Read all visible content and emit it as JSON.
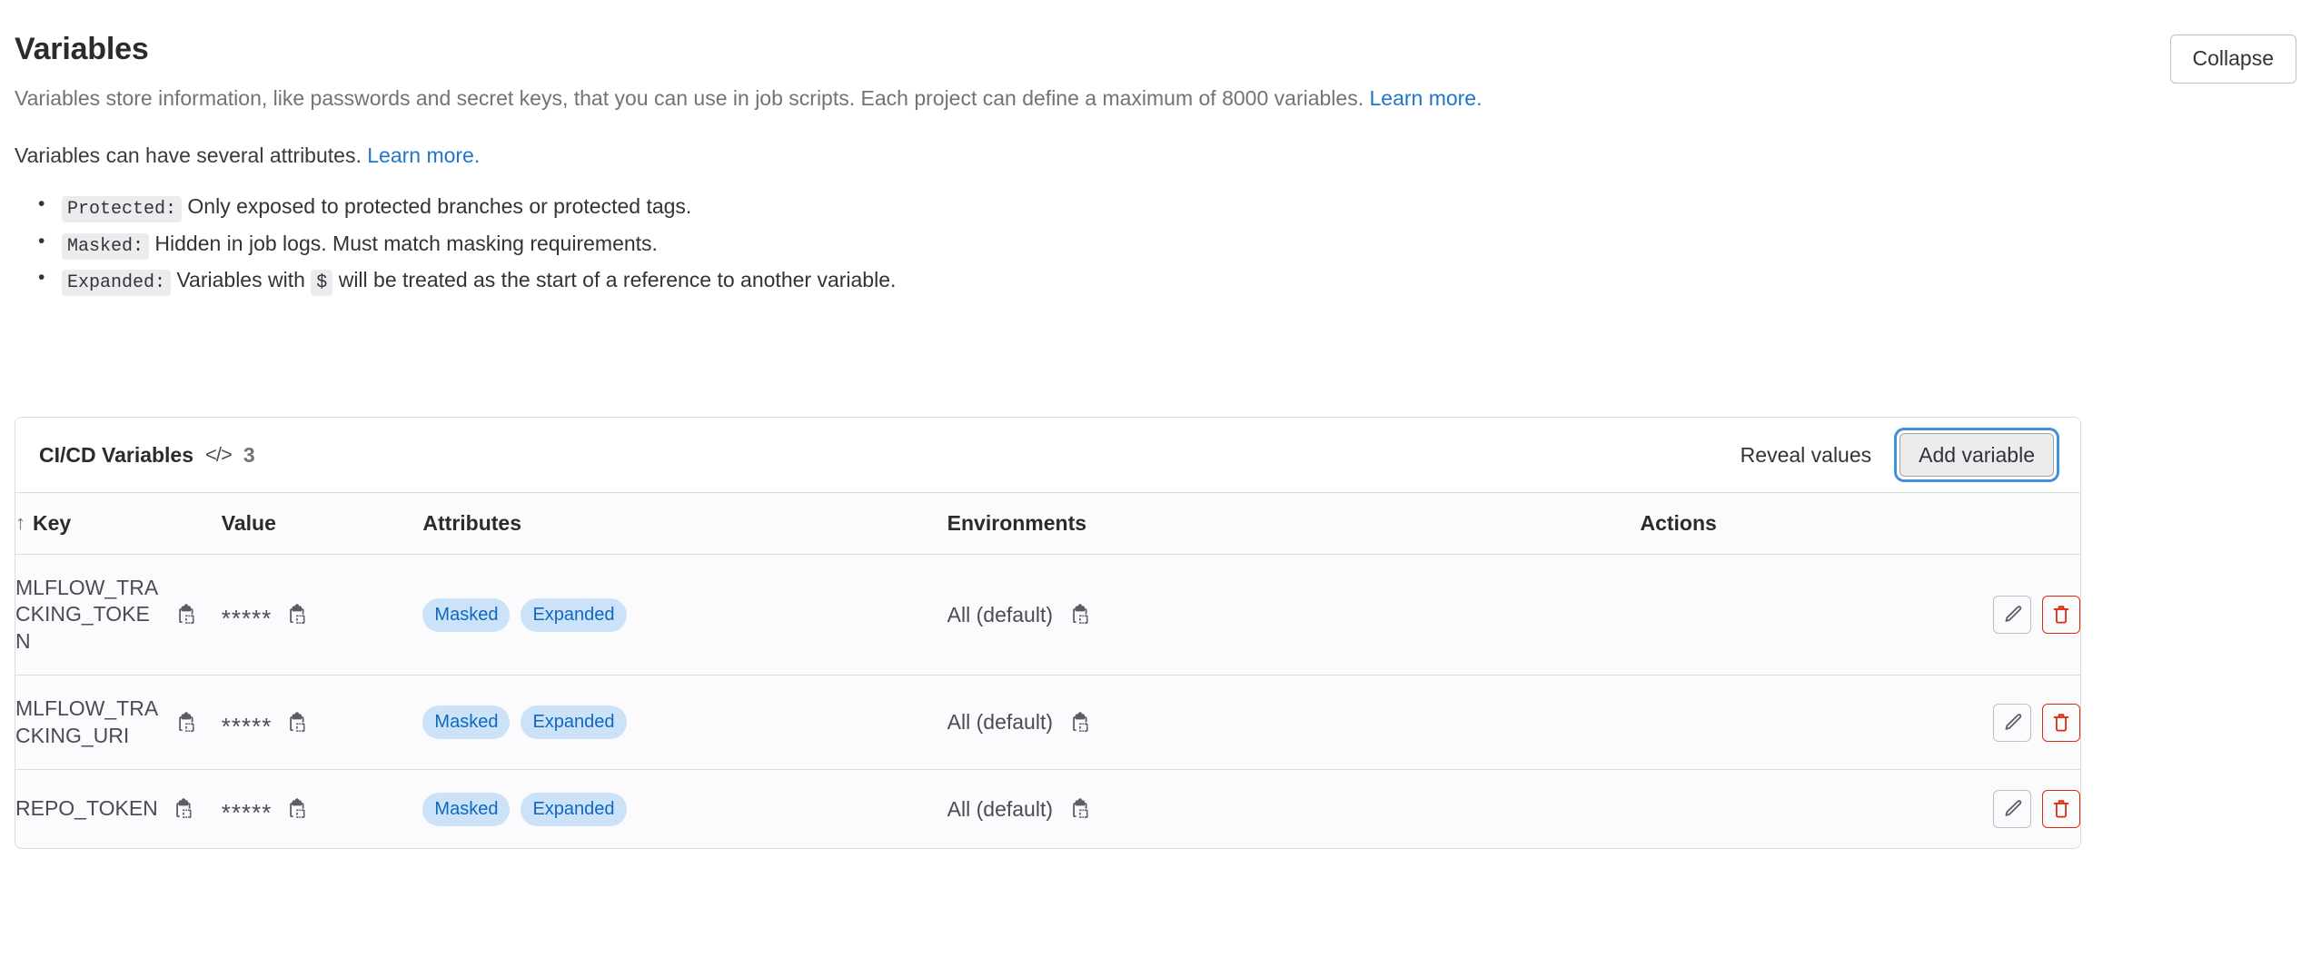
{
  "header": {
    "title": "Variables",
    "description_before_link": "Variables store information, like passwords and secret keys, that you can use in job scripts. Each project can define a maximum of 8000 variables. ",
    "description_link": "Learn more.",
    "attributes_intro": "Variables can have several attributes. ",
    "attributes_link": "Learn more.",
    "collapse_label": "Collapse"
  },
  "attributes": [
    {
      "code": "Protected:",
      "text_before": " Only exposed to protected branches or protected tags.",
      "inline_code": "",
      "text_after": ""
    },
    {
      "code": "Masked:",
      "text_before": " Hidden in job logs. Must match masking requirements.",
      "inline_code": "",
      "text_after": ""
    },
    {
      "code": "Expanded:",
      "text_before": " Variables with ",
      "inline_code": "$",
      "text_after": " will be treated as the start of a reference to another variable."
    }
  ],
  "card": {
    "title": "CI/CD Variables",
    "code_icon": "</>",
    "count": "3",
    "reveal_label": "Reveal values",
    "add_variable_label": "Add variable"
  },
  "table": {
    "sort_indicator": "↑",
    "columns": {
      "key": "Key",
      "value": "Value",
      "attributes": "Attributes",
      "environments": "Environments",
      "actions": "Actions"
    },
    "rows": [
      {
        "key": "MLFLOW_TRACKING_TOKEN",
        "value": "*****",
        "badges": [
          "Masked",
          "Expanded"
        ],
        "environment": "All (default)"
      },
      {
        "key": "MLFLOW_TRACKING_URI",
        "value": "*****",
        "badges": [
          "Masked",
          "Expanded"
        ],
        "environment": "All (default)"
      },
      {
        "key": "REPO_TOKEN",
        "value": "*****",
        "badges": [
          "Masked",
          "Expanded"
        ],
        "environment": "All (default)"
      }
    ]
  },
  "colors": {
    "link": "#1f75cb",
    "badge_bg": "#cbe2f9",
    "badge_text": "#1068bf",
    "danger": "#dd2b0e",
    "focus_ring": "#428fdc"
  }
}
